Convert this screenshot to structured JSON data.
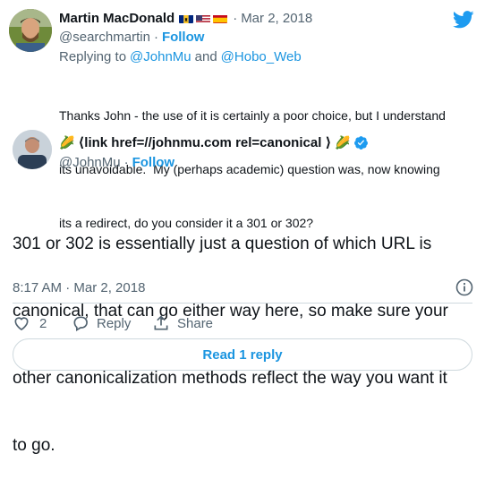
{
  "reply_tweet": {
    "display_name": "Martin MacDonald",
    "handle": "@searchmartin",
    "separator": "·",
    "follow_label": "Follow",
    "date": "Mar 2, 2018",
    "replying_prefix": "Replying to",
    "replying_user_1": "@JohnMu",
    "replying_and": "and",
    "replying_user_2": "@Hobo_Web",
    "text_line_1": "Thanks John - the use of it is certainly a poor choice, but I understand",
    "text_line_2": "its unavoidable.  My (perhaps academic) question was, now knowing",
    "text_line_3": "its a redirect, do you consider it a 301 or 302?"
  },
  "main_tweet": {
    "display_name": "⟨link href=//johnmu.com rel=canonical ⟩",
    "handle": "@JohnMu",
    "separator": "·",
    "follow_label": "Follow",
    "text_line_1": "301 or 302 is essentially just a question of which URL is",
    "text_line_2": "canonical, that can go either way here, so make sure your",
    "text_line_3": "other canonicalization methods reflect the way you want it",
    "text_line_4": "to go.",
    "timestamp": "8:17 AM · Mar 2, 2018",
    "like_count": "2",
    "reply_label": "Reply",
    "share_label": "Share"
  },
  "read_replies_label": "Read 1 reply",
  "colors": {
    "twitter_blue": "#1d9bf0",
    "link_blue": "#1b95e0",
    "secondary_text": "#536471",
    "divider": "#cfd9de"
  },
  "icons": [
    "twitter-bird-icon",
    "verified-badge-icon",
    "corn-emoji-icon",
    "barbados-flag-icon",
    "usa-flag-icon",
    "spain-flag-icon",
    "info-icon",
    "heart-icon",
    "reply-icon",
    "share-icon"
  ]
}
